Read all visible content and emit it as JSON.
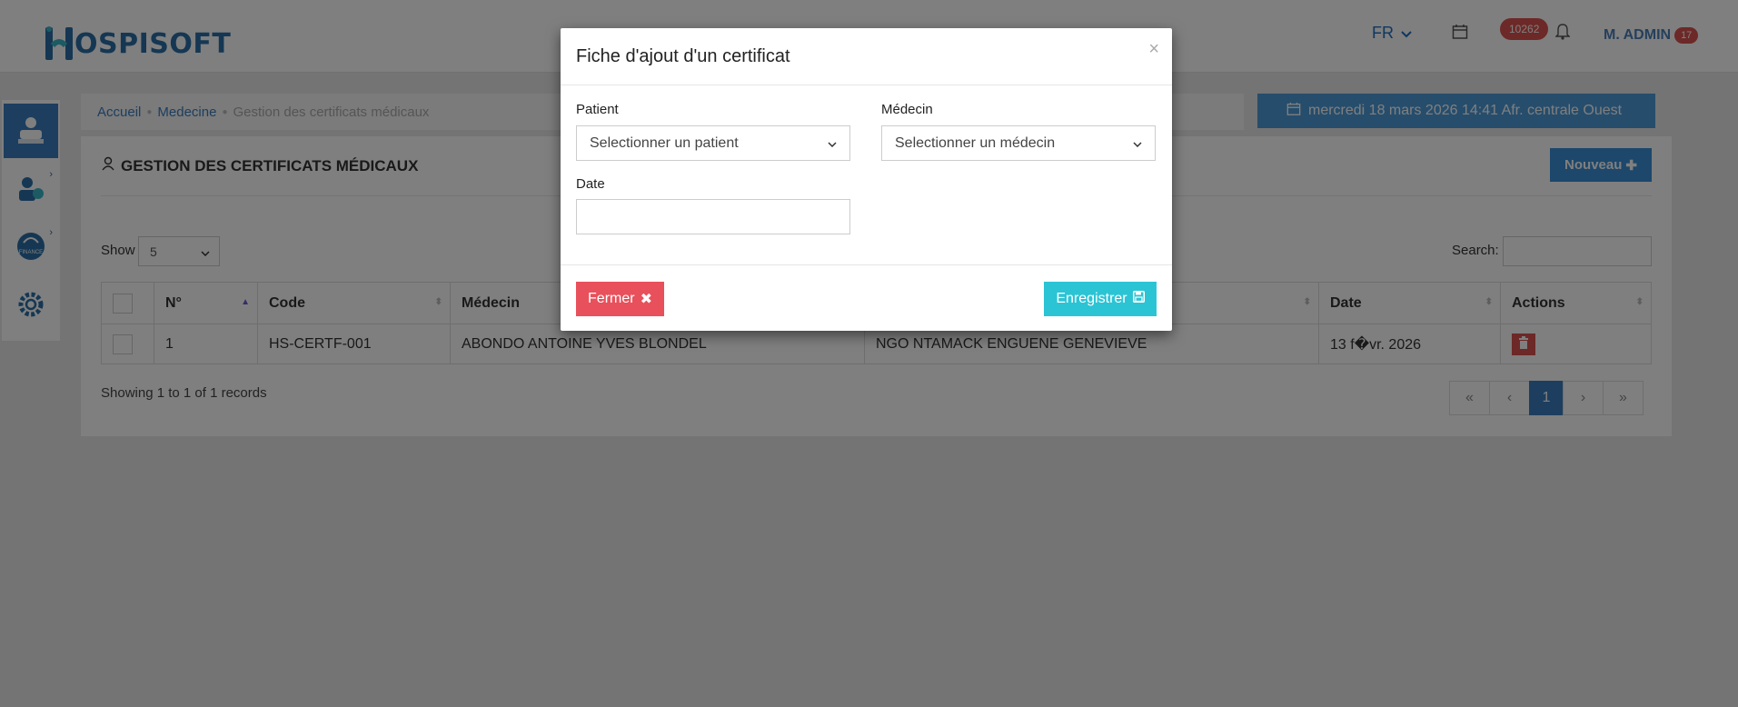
{
  "header": {
    "logo_text": "OSPISOFT",
    "logo_letter": "H",
    "language": "FR",
    "notification_count": "10262",
    "user_name": "M. ADMIN",
    "user_badge": "17",
    "brand_color": "#2a6fa7"
  },
  "sidebar": {
    "items": [
      {
        "icon": "doctor-icon",
        "active": true
      },
      {
        "icon": "nurse-icon",
        "active": false
      },
      {
        "icon": "finance-icon",
        "label": "FINANCE",
        "active": false
      },
      {
        "icon": "settings-gear-icon",
        "active": false
      }
    ]
  },
  "breadcrumb": {
    "home": "Accueil",
    "section": "Medecine",
    "current": "Gestion des certificats médicaux"
  },
  "datebar": {
    "text": "mercredi 18 mars 2026 14:41 Afr. centrale Ouest"
  },
  "panel": {
    "title": "GESTION DES CERTIFICATS MÉDICAUX",
    "new_button": "Nouveau",
    "show_label": "Show",
    "show_value": "5",
    "search_label": "Search:",
    "search_value": ""
  },
  "table": {
    "columns": [
      "N°",
      "Code",
      "Médecin",
      "",
      "Date",
      "Actions"
    ],
    "rows": [
      {
        "n": "1",
        "code": "HS-CERTF-001",
        "medecin": "ABONDO ANTOINE YVES BLONDEL",
        "patient": "NGO NTAMACK ENGUENE GENEVIEVE",
        "date": "13 f�vr. 2026"
      }
    ]
  },
  "footer": {
    "showing": "Showing 1 to 1 of 1 records",
    "pages": [
      "«",
      "‹",
      "1",
      "›",
      "»"
    ],
    "current_page": "1"
  },
  "modal": {
    "title": "Fiche d'ajout d'un certificat",
    "close_symbol": "×",
    "patient_label": "Patient",
    "patient_placeholder": "Selectionner un patient",
    "medecin_label": "Médecin",
    "medecin_placeholder": "Selectionner un médecin",
    "date_label": "Date",
    "date_value": "",
    "close_button": "Fermer",
    "save_button": "Enregistrer"
  },
  "colors": {
    "primary": "#3a7cbf",
    "danger": "#e8505b",
    "info": "#2bc4d4",
    "datebar": "#4d9ad8"
  }
}
